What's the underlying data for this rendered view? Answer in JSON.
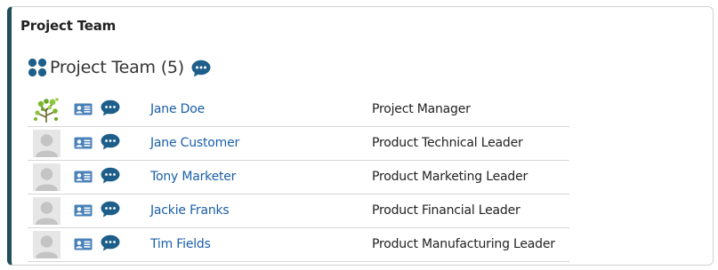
{
  "panel": {
    "title": "Project Team"
  },
  "section": {
    "title": "Project Team (5)",
    "team_icon": "team-group-icon",
    "chat_icon": "chat-bubble-icon"
  },
  "colors": {
    "panel_accent": "#1f4e5c",
    "link": "#1a5fa8",
    "icon_blue": "#1d5f8a",
    "card_icon": "#4a82b8"
  },
  "members": [
    {
      "name": "Jane Doe",
      "role": "Project Manager",
      "avatar": "tree-photo"
    },
    {
      "name": "Jane Customer",
      "role": "Product Technical Leader",
      "avatar": "default-person"
    },
    {
      "name": "Tony Marketer",
      "role": "Product Marketing Leader",
      "avatar": "default-person"
    },
    {
      "name": "Jackie Franks",
      "role": "Product Financial Leader",
      "avatar": "default-person"
    },
    {
      "name": "Tim Fields",
      "role": "Product Manufacturing Leader",
      "avatar": "default-person"
    }
  ]
}
